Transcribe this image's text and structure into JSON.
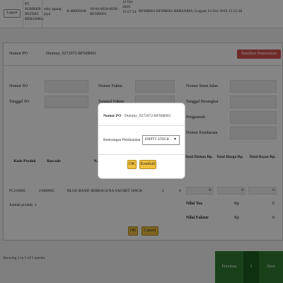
{
  "topbar": {
    "logout_label": "Logout",
    "company": "PT. SUMBER REZEKI BERSAMA",
    "outlet": "toko agung jaya",
    "code": "A-00005838",
    "doc_ref": "10-04-0020-0030-BFSIB001",
    "date_block": "12 Oct 2019 15:57:14",
    "user_status": "BFSIB001 BFSIB001 BERSAMA | Logout 12-Oct-2019 15:53:38"
  },
  "header": {
    "po_label": "Nomor PO",
    "po_value": "Dummy_9272972-BFSIB001",
    "cancel_order_label": "Batalkan Pemesanan"
  },
  "form": {
    "nomor_so": "Nomor SO",
    "tanggal_so": "Tanggal SO",
    "nomor_faktur": "Nomor Faktur",
    "tanggal_faktur": "Tanggal Faktur",
    "nomor_surat_jalan": "Nomor Surat Jalan",
    "tanggal_berangkat": "Tanggal Berangkat",
    "pengemudi": "Pengemudi",
    "nomor_kendaraan": "Nomor Kendaraan"
  },
  "table": {
    "headers": {
      "kode_produk": "Kode Produk",
      "barcode": "Barcode",
      "nama": "Na",
      "total_diskon": "Total Diskon Rp.",
      "total_harga": "Total Harga Rp.",
      "total_bayar": "Total Bayar Rp."
    },
    "row": {
      "kode_produk": "FC210005",
      "barcode": "21000005",
      "nama": "BLUE BAND SERBAGUNA SACHET 200GR",
      "qty1": "2",
      "qty2": "0",
      "diskon": "0",
      "harga": "0",
      "bayar": "0"
    },
    "jumlah_produk": "Jumlah produk: 1"
  },
  "totals": {
    "nilai_tax_label": "Nilai Tax",
    "nilai_faktur_label": "Nilai Faktur",
    "currency": "Rp",
    "tax_value": "0",
    "faktur_value": "0"
  },
  "footer_buttons": {
    "ok": "OK",
    "cancel": "Cancel"
  },
  "footer": {
    "showing": "Showing 1 to 5 of 5 entries",
    "previous": "Previous",
    "page": "1",
    "next": "Next"
  },
  "modal": {
    "po_label": "Nomor PO",
    "po_value": "Dummy_9272972-BFSIB001",
    "reason_label": "Keterangan Pembatalan",
    "reason_selected": "EMPTY STOCK",
    "ok_label": "OK",
    "back_label": "Kembali"
  }
}
